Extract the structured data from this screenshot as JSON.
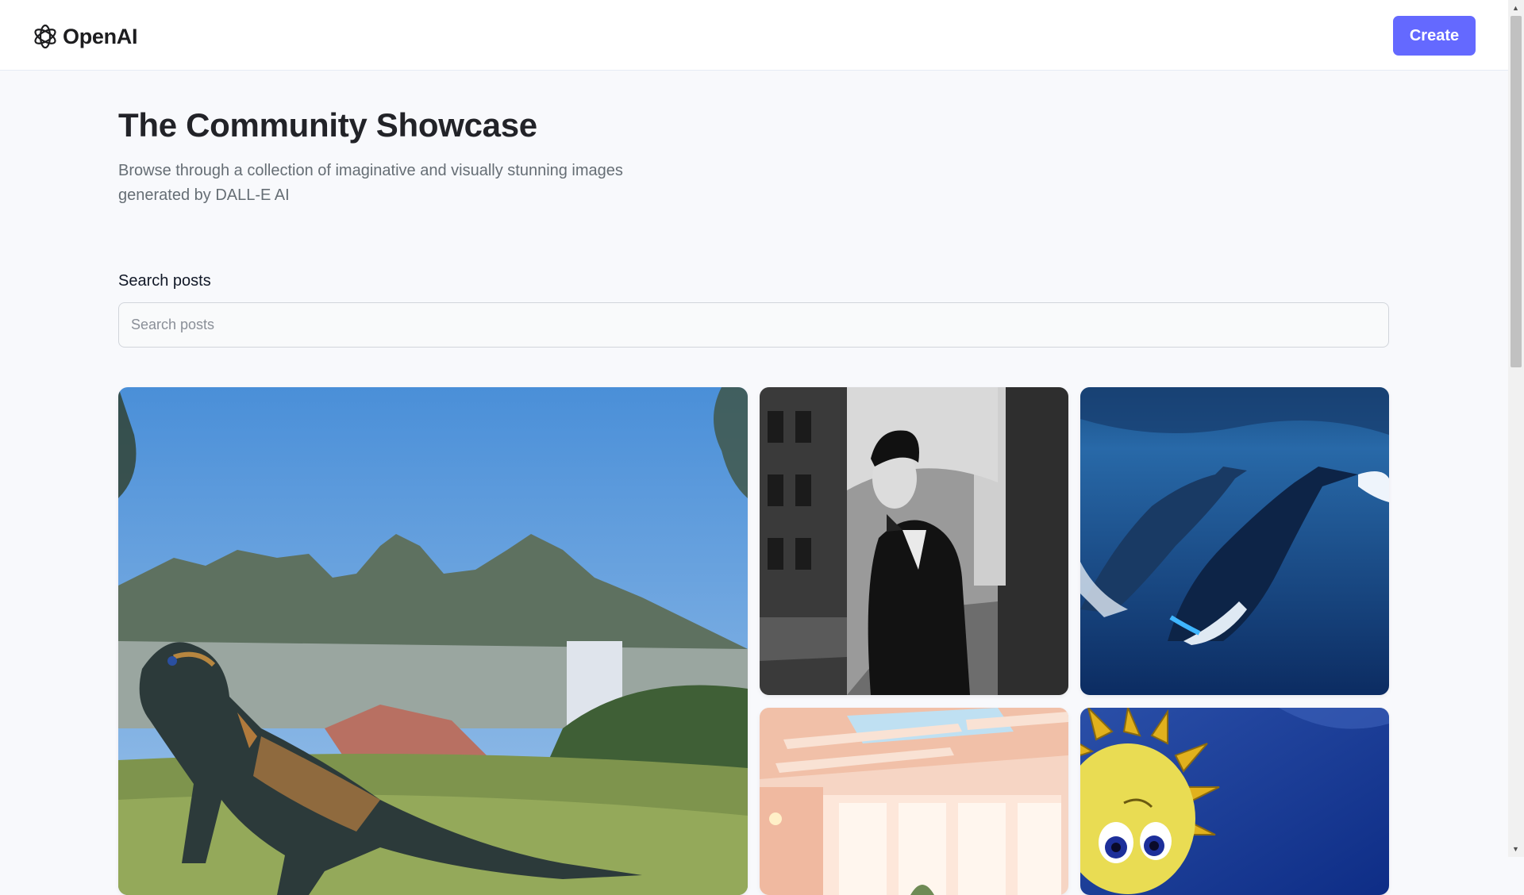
{
  "header": {
    "logo_text": "OpenAI",
    "logo_icon": "openai-logo-icon",
    "create_label": "Create",
    "accent_color": "#6469ff"
  },
  "hero": {
    "title": "The Community Showcase",
    "subtitle": "Browse through a collection of imaginative and visually stunning images generated by DALL-E AI"
  },
  "search": {
    "label": "Search posts",
    "placeholder": "Search posts",
    "value": ""
  },
  "gallery": {
    "items": [
      {
        "subject": "toy dinosaur in front of table mountain"
      },
      {
        "subject": "black and white man in suit on city street"
      },
      {
        "subject": "whales swimming underwater"
      },
      {
        "subject": "sunlit room with skylights"
      },
      {
        "subject": "cartoon sunflower face on blue sky"
      }
    ]
  }
}
